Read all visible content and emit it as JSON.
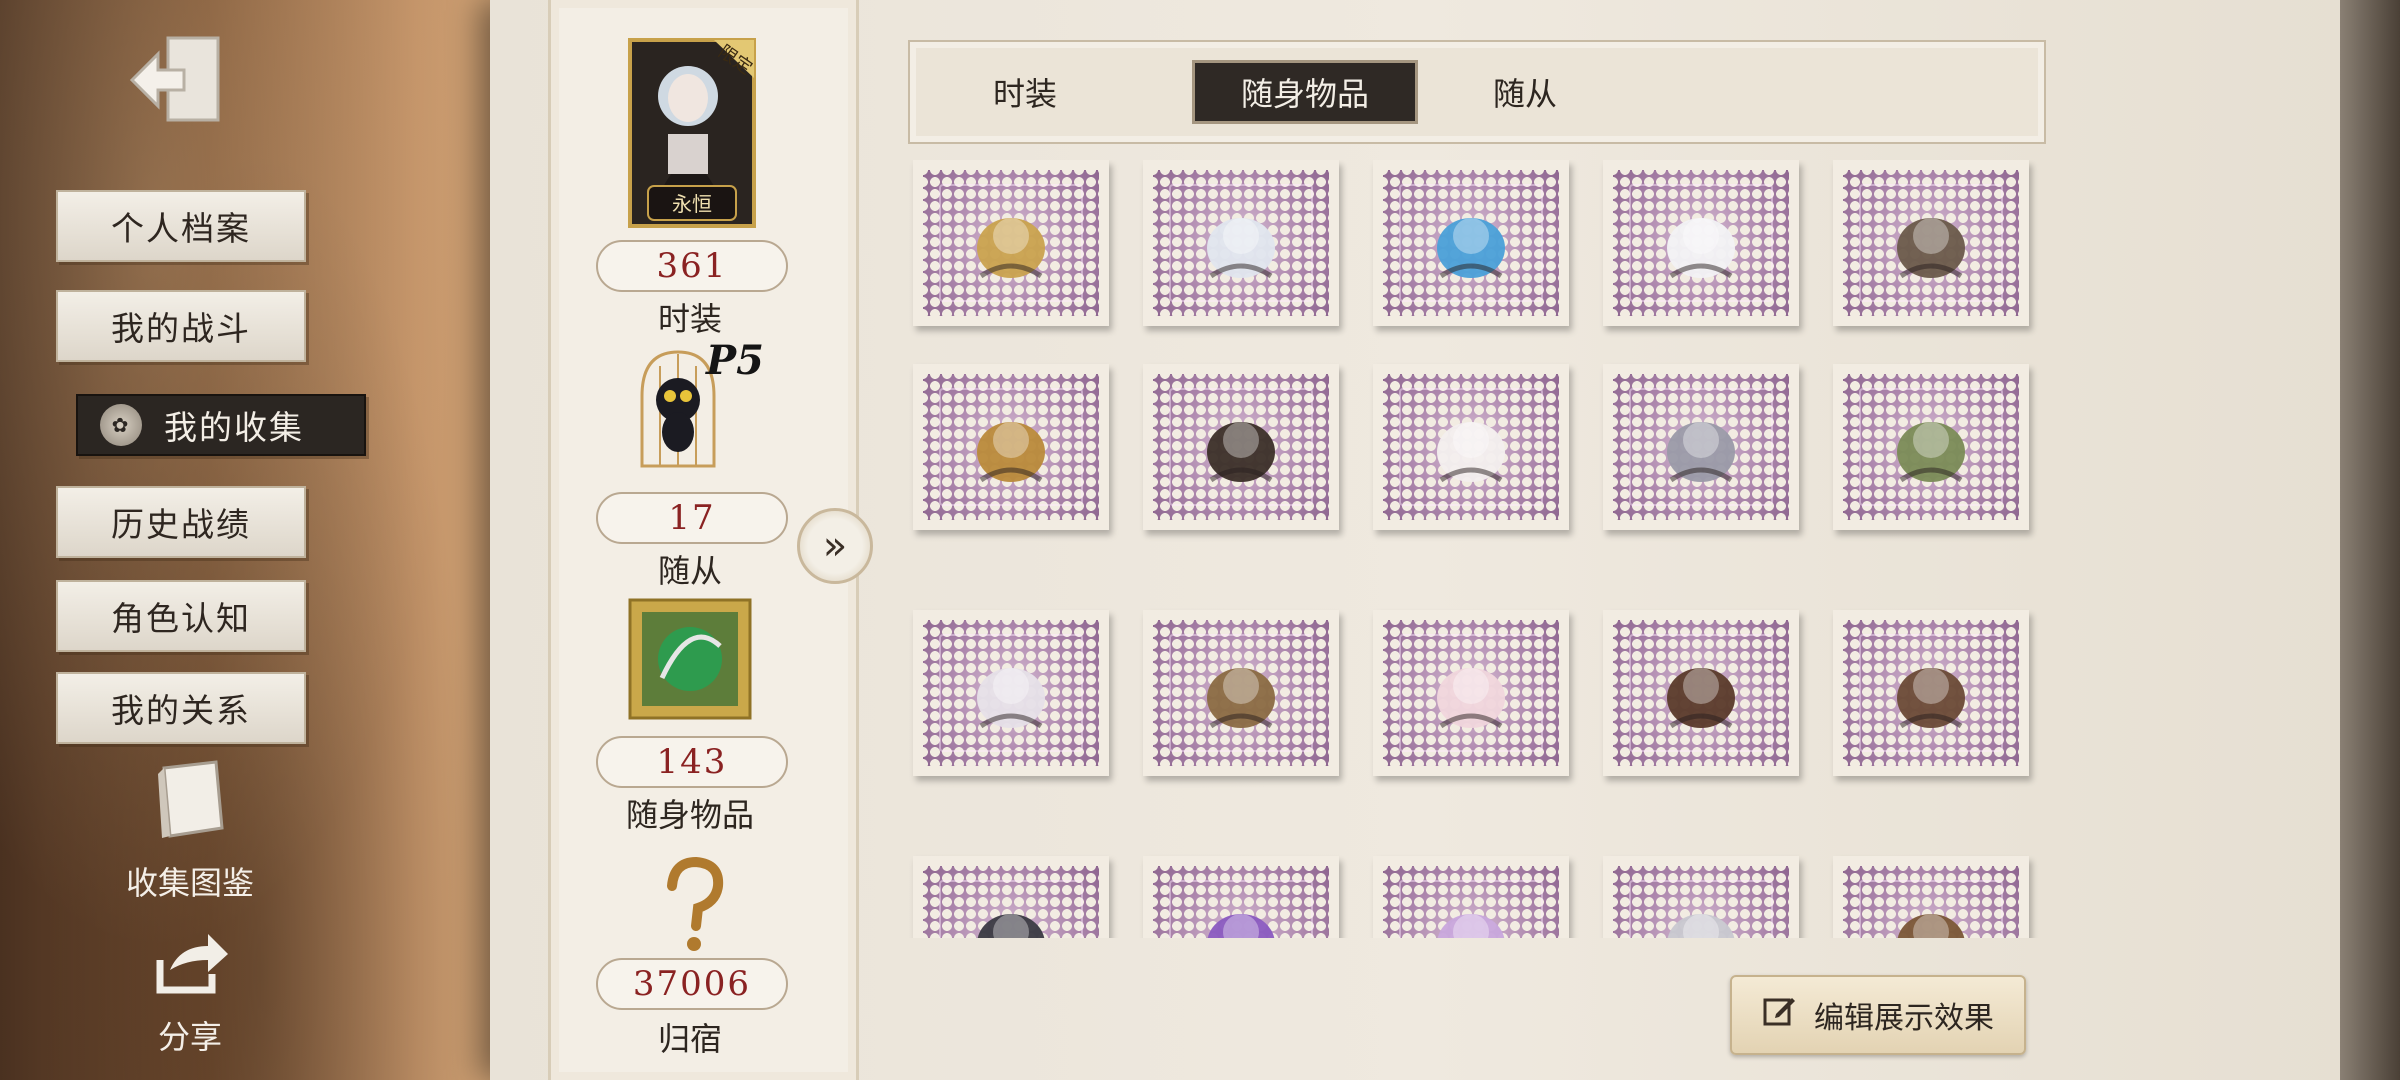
{
  "menu": {
    "items": [
      {
        "label": "个人档案"
      },
      {
        "label": "我的战斗"
      },
      {
        "label": "我的收集"
      },
      {
        "label": "历史战绩"
      },
      {
        "label": "角色认知"
      },
      {
        "label": "我的关系"
      }
    ],
    "active_index": 2,
    "codex_label": "收集图鉴",
    "share_label": "分享"
  },
  "stats": {
    "costume": {
      "badge": "限定",
      "frame_label": "永恒",
      "count": "361",
      "label": "时装"
    },
    "companion": {
      "badge": "P5",
      "count": "17",
      "label": "随从"
    },
    "accessory": {
      "count": "143",
      "label": "随身物品"
    },
    "home": {
      "count": "37006",
      "label": "归宿"
    }
  },
  "tabs": [
    {
      "label": "时装"
    },
    {
      "label": "随身物品"
    },
    {
      "label": "随从"
    }
  ],
  "active_tab": 1,
  "items": [
    {
      "name": "pocket-watch-icon"
    },
    {
      "name": "pufferfish-bowl-icon"
    },
    {
      "name": "blue-fin-trident-icon"
    },
    {
      "name": "snow-doll-icon"
    },
    {
      "name": "laurel-crown-icon"
    },
    {
      "name": "magic-flute-icon"
    },
    {
      "name": "torch-stand-icon"
    },
    {
      "name": "feather-quill-icon"
    },
    {
      "name": "star-mace-icon"
    },
    {
      "name": "dragonfly-icon"
    },
    {
      "name": "ghost-plush-icon"
    },
    {
      "name": "firecracker-icon"
    },
    {
      "name": "ballet-dress-icon"
    },
    {
      "name": "haunted-radio-icon"
    },
    {
      "name": "target-board-icon"
    },
    {
      "name": "dark-helmet-icon"
    },
    {
      "name": "violet-gem-icon"
    },
    {
      "name": "crystal-flower-icon"
    },
    {
      "name": "silver-orb-icon"
    },
    {
      "name": "bronze-bell-icon"
    }
  ],
  "edit_button": {
    "label": "编辑展示效果"
  },
  "colors": {
    "accent_red": "#8a2222",
    "stamp_purple": "#ad87ad",
    "active_dark": "#2f2925"
  }
}
